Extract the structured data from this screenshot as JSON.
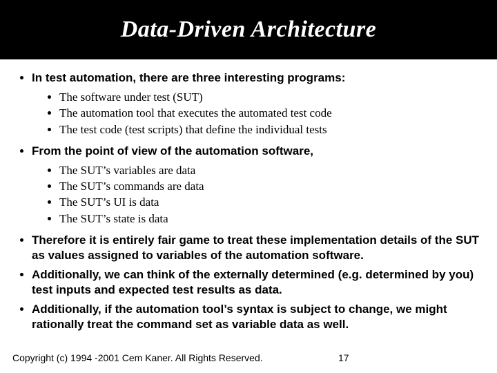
{
  "title": "Data-Driven Architecture",
  "bullets": [
    {
      "text": "In test automation, there are three interesting programs:",
      "sub": [
        "The software under test (SUT)",
        "The automation tool that executes the automated test code",
        "The test code (test scripts) that define the individual tests"
      ]
    },
    {
      "text": "From the point of view of the automation software,",
      "sub": [
        "The SUT’s variables are data",
        "The SUT’s commands are data",
        "The SUT’s UI is data",
        "The SUT’s state is data"
      ]
    },
    {
      "text": "Therefore it is entirely fair game to treat these implementation details of the SUT as values assigned to variables of the automation software.",
      "sub": []
    },
    {
      "text": "Additionally, we can think of the externally determined (e.g. determined by you) test inputs and expected test results as data.",
      "sub": []
    },
    {
      "text": "Additionally, if the automation tool’s syntax is subject to change, we might rationally treat the command set as variable data as well.",
      "sub": []
    }
  ],
  "footer": "Copyright (c) 1994 -2001 Cem Kaner. All Rights Reserved.",
  "page_number": "17"
}
